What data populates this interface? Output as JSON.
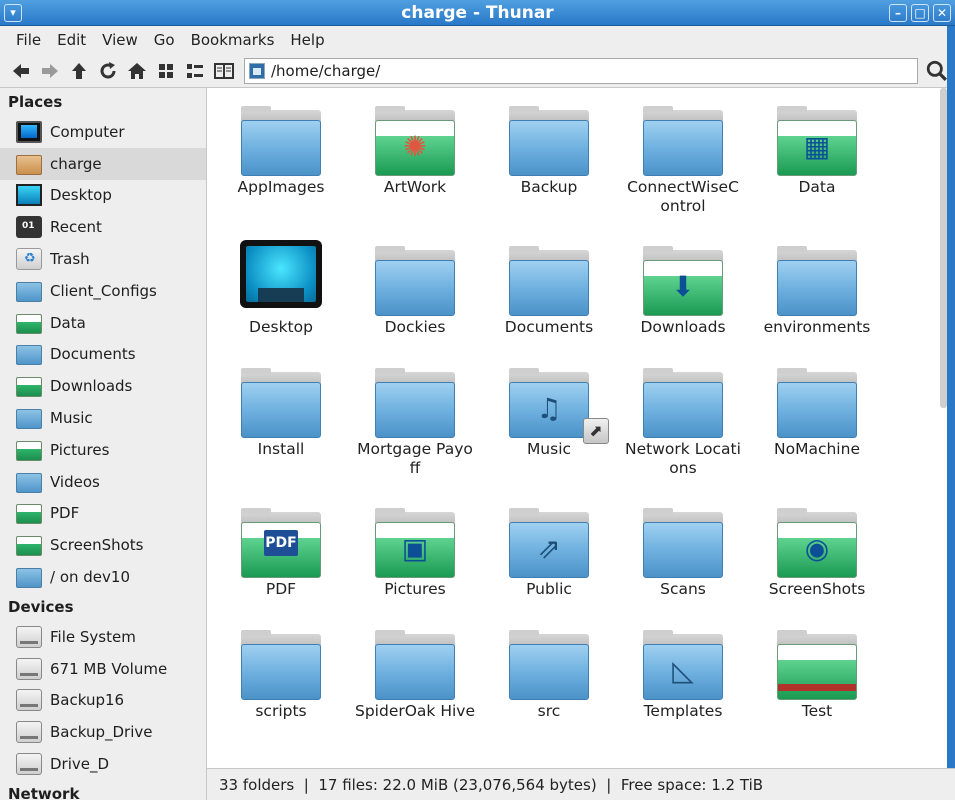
{
  "window": {
    "title": "charge - Thunar"
  },
  "menubar": [
    "File",
    "Edit",
    "View",
    "Go",
    "Bookmarks",
    "Help"
  ],
  "location": {
    "path": "/home/charge/"
  },
  "sidebar": {
    "places_heading": "Places",
    "places": [
      {
        "label": "Computer",
        "icon": "computer-icon"
      },
      {
        "label": "charge",
        "icon": "home-folder-icon",
        "selected": true
      },
      {
        "label": "Desktop",
        "icon": "desktop-icon"
      },
      {
        "label": "Recent",
        "icon": "recent-icon"
      },
      {
        "label": "Trash",
        "icon": "trash-icon"
      },
      {
        "label": "Client_Configs",
        "icon": "folder-icon"
      },
      {
        "label": "Data",
        "icon": "data-folder-icon"
      },
      {
        "label": "Documents",
        "icon": "folder-icon"
      },
      {
        "label": "Downloads",
        "icon": "downloads-folder-icon"
      },
      {
        "label": "Music",
        "icon": "music-folder-icon"
      },
      {
        "label": "Pictures",
        "icon": "pictures-folder-icon"
      },
      {
        "label": "Videos",
        "icon": "videos-folder-icon"
      },
      {
        "label": "PDF",
        "icon": "pdf-folder-icon"
      },
      {
        "label": "ScreenShots",
        "icon": "screenshots-folder-icon"
      },
      {
        "label": "/ on dev10",
        "icon": "network-folder-icon"
      }
    ],
    "devices_heading": "Devices",
    "devices": [
      {
        "label": "File System",
        "icon": "drive-icon"
      },
      {
        "label": "671 MB Volume",
        "icon": "eject-drive-icon"
      },
      {
        "label": "Backup16",
        "icon": "usb-drive-icon"
      },
      {
        "label": "Backup_Drive",
        "icon": "drive-icon"
      },
      {
        "label": "Drive_D",
        "icon": "drive-icon"
      }
    ],
    "network_heading": "Network"
  },
  "files": [
    {
      "label": "AppImages",
      "kind": "folder"
    },
    {
      "label": "ArtWork",
      "kind": "art"
    },
    {
      "label": "Backup",
      "kind": "folder"
    },
    {
      "label": "ConnectWiseControl",
      "kind": "folder"
    },
    {
      "label": "Data",
      "kind": "data"
    },
    {
      "label": "Desktop",
      "kind": "desktop"
    },
    {
      "label": "Dockies",
      "kind": "folder"
    },
    {
      "label": "Documents",
      "kind": "folder"
    },
    {
      "label": "Downloads",
      "kind": "downloads"
    },
    {
      "label": "environments",
      "kind": "folder"
    },
    {
      "label": "Install",
      "kind": "folder"
    },
    {
      "label": "Mortgage Payoff",
      "kind": "folder"
    },
    {
      "label": "Music",
      "kind": "music"
    },
    {
      "label": "Network Locations",
      "kind": "folder"
    },
    {
      "label": "NoMachine",
      "kind": "folder"
    },
    {
      "label": "PDF",
      "kind": "pdf"
    },
    {
      "label": "Pictures",
      "kind": "pictures"
    },
    {
      "label": "Public",
      "kind": "public"
    },
    {
      "label": "Scans",
      "kind": "folder"
    },
    {
      "label": "ScreenShots",
      "kind": "screenshots"
    },
    {
      "label": "scripts",
      "kind": "folder"
    },
    {
      "label": "SpiderOak Hive",
      "kind": "folder"
    },
    {
      "label": "src",
      "kind": "folder"
    },
    {
      "label": "Templates",
      "kind": "templates"
    },
    {
      "label": "Test",
      "kind": "test"
    }
  ],
  "status": {
    "text": "33 folders  |  17 files: 22.0 MiB (23,076,564 bytes)  |  Free space: 1.2 TiB"
  }
}
